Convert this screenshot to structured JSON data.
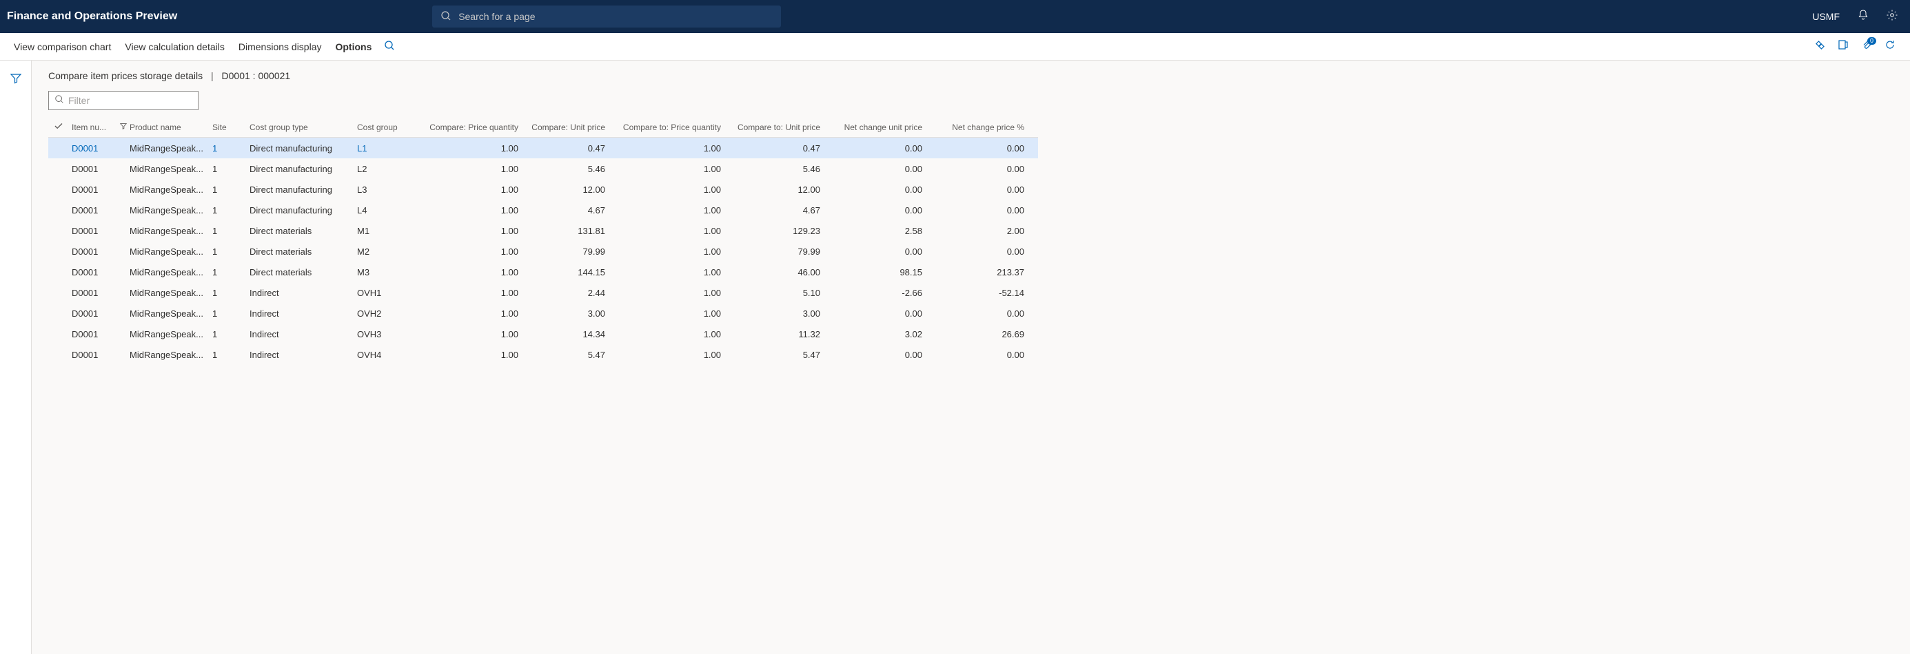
{
  "topbar": {
    "title": "Finance and Operations Preview",
    "search_placeholder": "Search for a page",
    "company": "USMF"
  },
  "actionbar": {
    "cmd_view_chart": "View comparison chart",
    "cmd_view_calc": "View calculation details",
    "cmd_dimensions": "Dimensions display",
    "cmd_options": "Options"
  },
  "page": {
    "title": "Compare item prices storage details",
    "record": "D0001 : 000021",
    "filter_placeholder": "Filter"
  },
  "grid": {
    "headers": {
      "item": "Item nu...",
      "product": "Product name",
      "site": "Site",
      "cgt": "Cost group type",
      "cg": "Cost group",
      "cpq": "Compare: Price quantity",
      "cup": "Compare: Unit price",
      "ctpq": "Compare to: Price quantity",
      "ctup": "Compare to: Unit price",
      "ncup": "Net change unit price",
      "ncpp": "Net change price %"
    },
    "rows": [
      {
        "selected": true,
        "link": true,
        "item": "D0001",
        "product": "MidRangeSpeak...",
        "site": "1",
        "cgt": "Direct manufacturing",
        "cg": "L1",
        "cpq": "1.00",
        "cup": "0.47",
        "ctpq": "1.00",
        "ctup": "0.47",
        "ncup": "0.00",
        "ncpp": "0.00"
      },
      {
        "selected": false,
        "link": false,
        "item": "D0001",
        "product": "MidRangeSpeak...",
        "site": "1",
        "cgt": "Direct manufacturing",
        "cg": "L2",
        "cpq": "1.00",
        "cup": "5.46",
        "ctpq": "1.00",
        "ctup": "5.46",
        "ncup": "0.00",
        "ncpp": "0.00"
      },
      {
        "selected": false,
        "link": false,
        "item": "D0001",
        "product": "MidRangeSpeak...",
        "site": "1",
        "cgt": "Direct manufacturing",
        "cg": "L3",
        "cpq": "1.00",
        "cup": "12.00",
        "ctpq": "1.00",
        "ctup": "12.00",
        "ncup": "0.00",
        "ncpp": "0.00"
      },
      {
        "selected": false,
        "link": false,
        "item": "D0001",
        "product": "MidRangeSpeak...",
        "site": "1",
        "cgt": "Direct manufacturing",
        "cg": "L4",
        "cpq": "1.00",
        "cup": "4.67",
        "ctpq": "1.00",
        "ctup": "4.67",
        "ncup": "0.00",
        "ncpp": "0.00"
      },
      {
        "selected": false,
        "link": false,
        "item": "D0001",
        "product": "MidRangeSpeak...",
        "site": "1",
        "cgt": "Direct materials",
        "cg": "M1",
        "cpq": "1.00",
        "cup": "131.81",
        "ctpq": "1.00",
        "ctup": "129.23",
        "ncup": "2.58",
        "ncpp": "2.00"
      },
      {
        "selected": false,
        "link": false,
        "item": "D0001",
        "product": "MidRangeSpeak...",
        "site": "1",
        "cgt": "Direct materials",
        "cg": "M2",
        "cpq": "1.00",
        "cup": "79.99",
        "ctpq": "1.00",
        "ctup": "79.99",
        "ncup": "0.00",
        "ncpp": "0.00"
      },
      {
        "selected": false,
        "link": false,
        "item": "D0001",
        "product": "MidRangeSpeak...",
        "site": "1",
        "cgt": "Direct materials",
        "cg": "M3",
        "cpq": "1.00",
        "cup": "144.15",
        "ctpq": "1.00",
        "ctup": "46.00",
        "ncup": "98.15",
        "ncpp": "213.37"
      },
      {
        "selected": false,
        "link": false,
        "item": "D0001",
        "product": "MidRangeSpeak...",
        "site": "1",
        "cgt": "Indirect",
        "cg": "OVH1",
        "cpq": "1.00",
        "cup": "2.44",
        "ctpq": "1.00",
        "ctup": "5.10",
        "ncup": "-2.66",
        "ncpp": "-52.14"
      },
      {
        "selected": false,
        "link": false,
        "item": "D0001",
        "product": "MidRangeSpeak...",
        "site": "1",
        "cgt": "Indirect",
        "cg": "OVH2",
        "cpq": "1.00",
        "cup": "3.00",
        "ctpq": "1.00",
        "ctup": "3.00",
        "ncup": "0.00",
        "ncpp": "0.00"
      },
      {
        "selected": false,
        "link": false,
        "item": "D0001",
        "product": "MidRangeSpeak...",
        "site": "1",
        "cgt": "Indirect",
        "cg": "OVH3",
        "cpq": "1.00",
        "cup": "14.34",
        "ctpq": "1.00",
        "ctup": "11.32",
        "ncup": "3.02",
        "ncpp": "26.69"
      },
      {
        "selected": false,
        "link": false,
        "item": "D0001",
        "product": "MidRangeSpeak...",
        "site": "1",
        "cgt": "Indirect",
        "cg": "OVH4",
        "cpq": "1.00",
        "cup": "5.47",
        "ctpq": "1.00",
        "ctup": "5.47",
        "ncup": "0.00",
        "ncpp": "0.00"
      }
    ]
  }
}
